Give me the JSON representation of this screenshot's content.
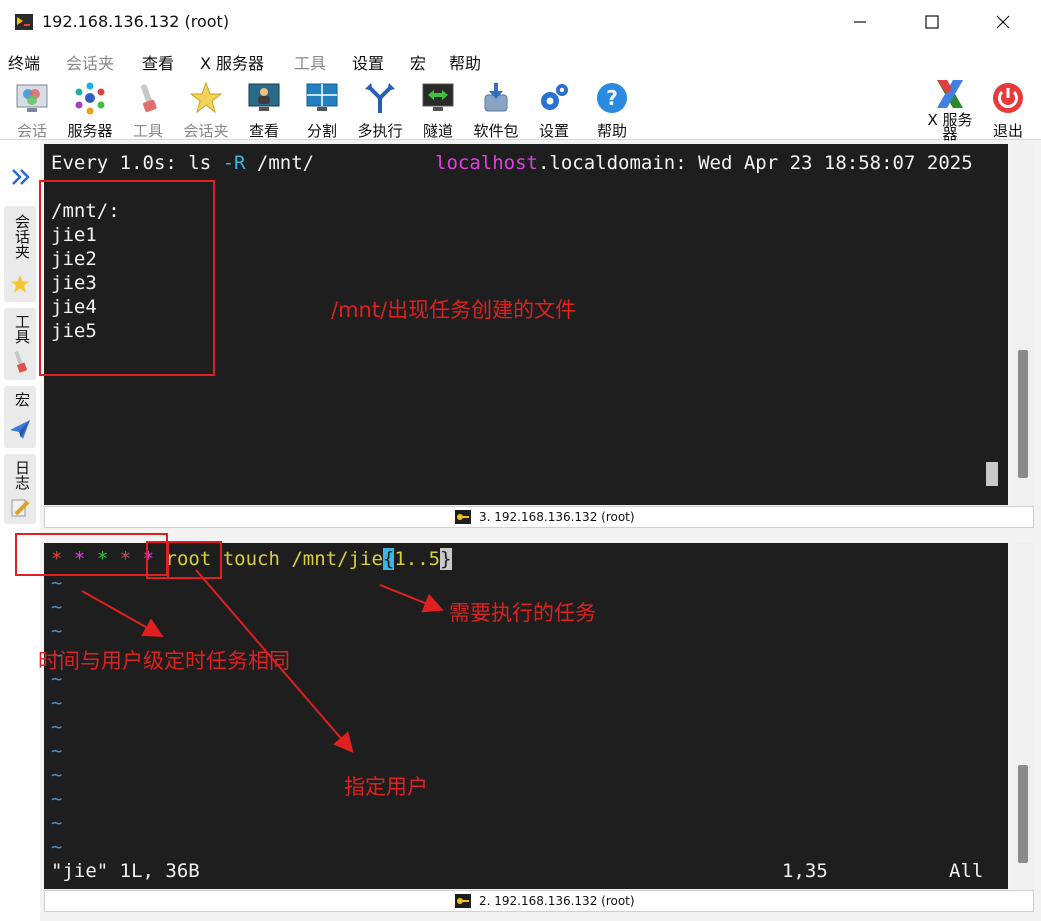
{
  "window": {
    "title": "192.168.136.132 (root)"
  },
  "menu": {
    "items": [
      "终端",
      "会话夹",
      "查看",
      "X 服务器",
      "工具",
      "设置",
      "宏",
      "帮助"
    ]
  },
  "toolbar": {
    "session": "会话",
    "servers": "服务器",
    "tools": "工具",
    "sessions_folder": "会话夹",
    "view": "查看",
    "split": "分割",
    "multiexec": "多执行",
    "tunnel": "隧道",
    "packages": "软件包",
    "settings": "设置",
    "help": "帮助",
    "xserver_line1": "X 服务",
    "xserver_line2": "器",
    "exit": "退出"
  },
  "dock": {
    "sessions": "会话夹",
    "tools": "工具",
    "macros": "宏",
    "log": "日志"
  },
  "top_terminal": {
    "header_every": "Every 1.0s: ls ",
    "header_flag": "-R",
    "header_path": " /mnt/",
    "header_host": "localhost",
    "header_rest": ".localdomain: Wed Apr 23 18:58:07 2025",
    "lines": [
      "/mnt/:",
      "jie1",
      "jie2",
      "jie3",
      "jie4",
      "jie5"
    ],
    "status": "3. 192.168.136.132 (root)"
  },
  "bottom_terminal": {
    "stars": [
      "*",
      "*",
      "*",
      "*",
      "*"
    ],
    "cmd_user": "root",
    "cmd_touch": " touch /mnt/jie",
    "cmd_brace_open": "{",
    "cmd_range": "1..5",
    "cmd_brace_close": "}",
    "tilde": "~",
    "file_info": "\"jie\" 1L, 36B",
    "position": "1,35",
    "scroll": "All",
    "status": "2. 192.168.136.132 (root)"
  },
  "annotations": {
    "top_note": "/mnt/出现任务创建的文件",
    "task_note": "需要执行的任务",
    "time_note": "时间与用户级定时任务相同",
    "user_note": "指定用户"
  },
  "colors": {
    "terminal_bg": "#1e1e1e",
    "annotation_red": "#e02020",
    "vim_tilde": "#3b8fd6"
  }
}
